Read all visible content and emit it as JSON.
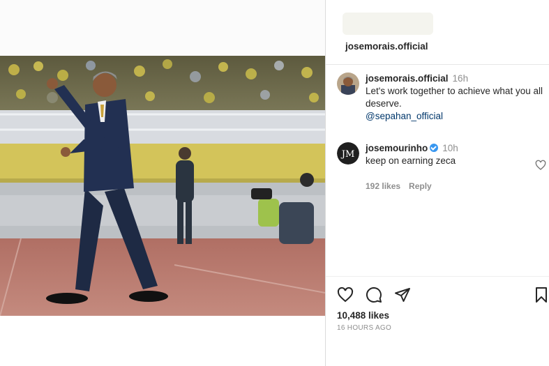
{
  "header": {
    "username": "josemorais.official"
  },
  "comments": [
    {
      "username": "josemorais.official",
      "time": "16h",
      "text": "Let's work together to achieve what you all deserve.",
      "mention": "@sepahan_official"
    },
    {
      "username": "josemourinho",
      "verified": true,
      "time": "10h",
      "text": "keep on earning zeca",
      "likes": "192 likes",
      "reply_label": "Reply"
    }
  ],
  "post": {
    "likes": "10,488 likes",
    "timestamp": "16 HOURS AGO"
  },
  "icons": {
    "like": "heart-icon",
    "comment": "comment-icon",
    "share": "paper-plane-icon",
    "save": "bookmark-icon",
    "comment_like": "heart-icon"
  },
  "colors": {
    "mention": "#00376b",
    "verified": "#3897f0",
    "muted": "#8e8e8e"
  }
}
